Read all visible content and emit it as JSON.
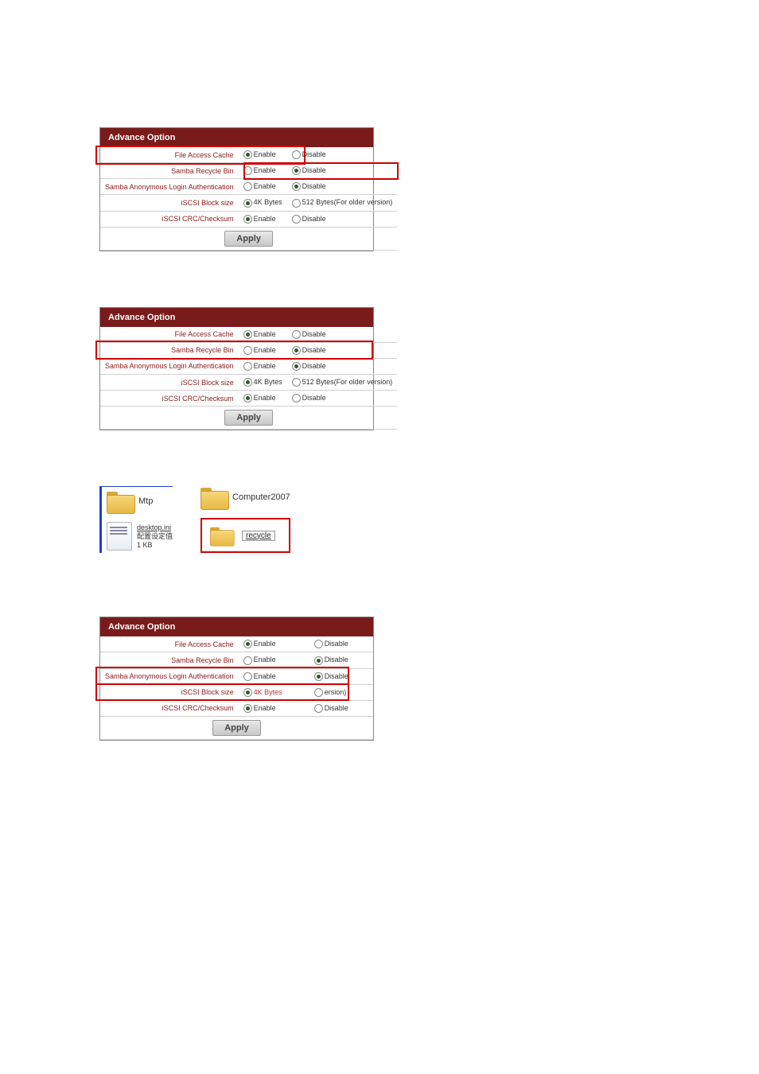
{
  "panel": {
    "title": "Advance Option",
    "apply": "Apply",
    "rows": {
      "r1": {
        "label": "File Access Cache",
        "a": "Enable",
        "b": "Disable"
      },
      "r2": {
        "label": "Samba Recycle Bin",
        "a": "Enable",
        "b": "Disable"
      },
      "r3": {
        "label": "Samba Anonymous Login Authentication",
        "a": "Enable",
        "b": "Disable"
      },
      "r4": {
        "label": "iSCSI Block size",
        "a": "4K Bytes",
        "b": "512 Bytes(For older version)"
      },
      "r5": {
        "label": "iSCSI CRC/Checksum",
        "a": "Enable",
        "b": "Disable"
      }
    }
  },
  "panel3_row4_suffix": "ersion)",
  "files": {
    "left": {
      "folder": "Mtp",
      "ini_name": "desktop.ini",
      "ini_sub1": "配置设定值",
      "ini_sub2": "1 KB"
    },
    "right": {
      "folder": "Computer2007",
      "recycle": "recycle"
    }
  }
}
